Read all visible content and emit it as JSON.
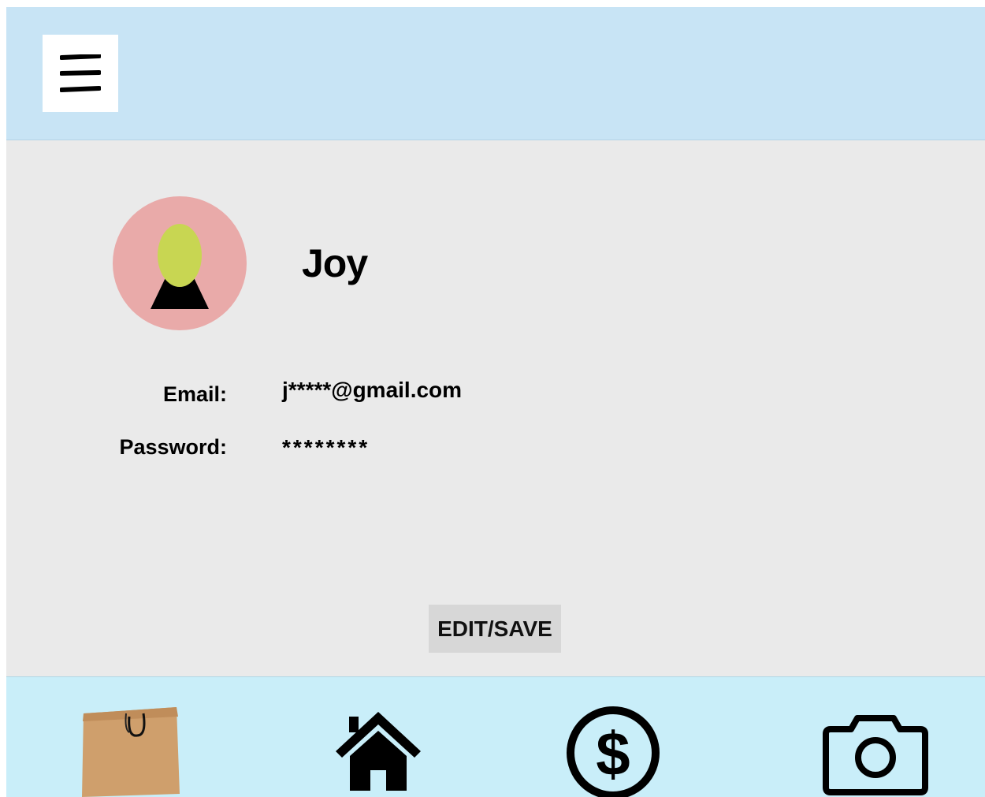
{
  "profile": {
    "name": "Joy",
    "email_label": "Email:",
    "email_value": "j*****@gmail.com",
    "password_label": "Password:",
    "password_value": "********"
  },
  "actions": {
    "edit_save_label": "EDIT/SAVE"
  },
  "icons": {
    "menu": "hamburger-menu-icon",
    "avatar": "user-avatar-icon",
    "shop": "shopping-bag-icon",
    "home": "home-icon",
    "money": "dollar-circle-icon",
    "camera": "camera-icon"
  },
  "colors": {
    "header_bg": "#c8e4f5",
    "content_bg": "#eaeaea",
    "footer_bg": "#c9eef9",
    "avatar_bg": "#e9aaa9",
    "avatar_head": "#c8d652",
    "button_bg": "#d7d7d7"
  }
}
